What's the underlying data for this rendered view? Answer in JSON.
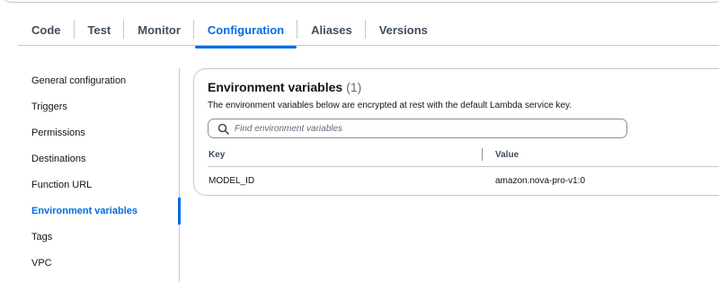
{
  "tabs": [
    {
      "label": "Code"
    },
    {
      "label": "Test"
    },
    {
      "label": "Monitor"
    },
    {
      "label": "Configuration",
      "active": true
    },
    {
      "label": "Aliases"
    },
    {
      "label": "Versions"
    }
  ],
  "sidebar": {
    "items": [
      {
        "label": "General configuration"
      },
      {
        "label": "Triggers"
      },
      {
        "label": "Permissions"
      },
      {
        "label": "Destinations"
      },
      {
        "label": "Function URL"
      },
      {
        "label": "Environment variables",
        "active": true
      },
      {
        "label": "Tags"
      },
      {
        "label": "VPC"
      }
    ]
  },
  "panel": {
    "title": "Environment variables",
    "count": "(1)",
    "description": "The environment variables below are encrypted at rest with the default Lambda service key.",
    "search": {
      "placeholder": "Find environment variables",
      "value": ""
    },
    "columns": {
      "key": "Key",
      "value": "Value"
    },
    "rows": [
      {
        "key": "MODEL_ID",
        "value": "amazon.nova-pro-v1:0"
      }
    ]
  },
  "colors": {
    "accent": "#006ce0",
    "border": "#c6c6cd",
    "text": "#0f141a"
  },
  "icons": {
    "search": "search-icon"
  }
}
